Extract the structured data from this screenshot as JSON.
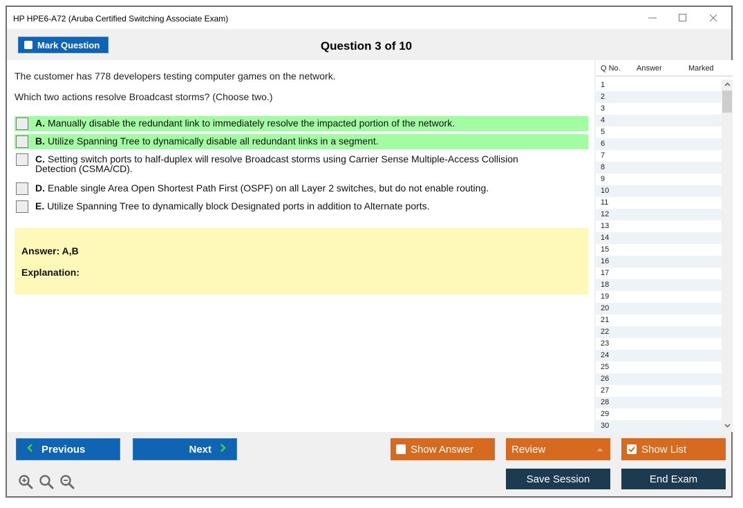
{
  "window": {
    "title": "HP HPE6-A72 (Aruba Certified Switching Associate Exam)",
    "controls": {
      "minimize": "—",
      "maximize": "☐",
      "close": "✕"
    }
  },
  "toolbar": {
    "mark_question_label": "Mark Question",
    "question_header": "Question 3 of 10"
  },
  "question": {
    "stem": "The customer has 778 developers testing computer games on the network.",
    "prompt": "Which two actions resolve Broadcast storms? (Choose two.)",
    "options": [
      {
        "letter": "A.",
        "text": "Manually disable the redundant link to immediately resolve the impacted portion of the network.",
        "correct": true
      },
      {
        "letter": "B.",
        "text": "Utilize Spanning Tree to dynamically disable all redundant links in a segment.",
        "correct": true
      },
      {
        "letter": "C.",
        "text": "Setting switch ports to half-duplex will resolve Broadcast storms using Carrier Sense Multiple-Access Collision Detection (CSMA/CD).",
        "correct": false
      },
      {
        "letter": "D.",
        "text": "Enable single Area Open Shortest Path First (OSPF) on all Layer 2 switches, but do not enable routing.",
        "correct": false
      },
      {
        "letter": "E.",
        "text": "Utilize Spanning Tree to dynamically block Designated ports in addition to Alternate ports.",
        "correct": false
      }
    ]
  },
  "answer": {
    "answer_label": "Answer: A,B",
    "explanation_label": "Explanation:"
  },
  "question_list": {
    "headers": [
      "Q No.",
      "Answer",
      "Marked"
    ],
    "rows": [
      "1",
      "2",
      "3",
      "4",
      "5",
      "6",
      "7",
      "8",
      "9",
      "10",
      "11",
      "12",
      "13",
      "14",
      "15",
      "16",
      "17",
      "18",
      "19",
      "20",
      "21",
      "22",
      "23",
      "24",
      "25",
      "26",
      "27",
      "28",
      "29",
      "30"
    ],
    "scroll_up": "^",
    "scroll_down": "v"
  },
  "footer": {
    "previous_label": "Previous",
    "next_label": "Next",
    "show_answer_label": "Show Answer",
    "show_answer_checked": false,
    "review_label": "Review",
    "show_list_label": "Show List",
    "show_list_checked": true,
    "save_session_label": "Save Session",
    "end_exam_label": "End Exam"
  },
  "colors": {
    "primary_blue": "#0f64b4",
    "orange": "#d66a1f",
    "navy": "#1c3a50",
    "correct_green": "#a2fca2",
    "answer_yellow": "#fef9b8",
    "arrow_green": "#3fd23f"
  }
}
